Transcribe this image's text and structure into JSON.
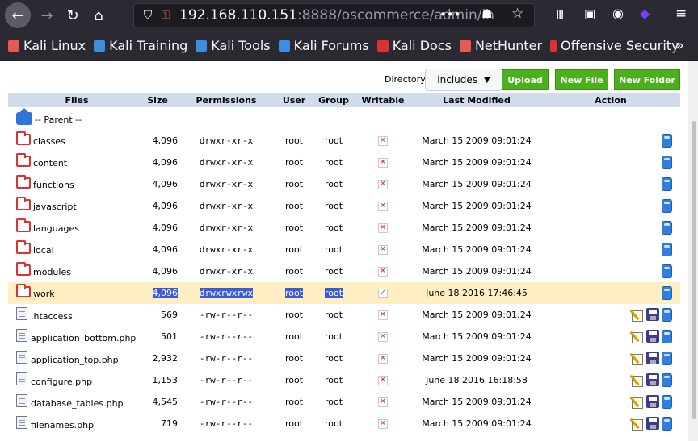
{
  "browser": {
    "url_host": "192.168.110.151",
    "url_path": ":8888/oscommerce/admin/in",
    "bookmarks": [
      {
        "label": "Kali Linux",
        "color": "#e85a4f"
      },
      {
        "label": "Kali Training",
        "color": "#3b8fe0"
      },
      {
        "label": "Kali Tools",
        "color": "#3b8fe0"
      },
      {
        "label": "Kali Forums",
        "color": "#3b8fe0"
      },
      {
        "label": "Kali Docs",
        "color": "#e03030"
      },
      {
        "label": "NetHunter",
        "color": "#e85a4f"
      },
      {
        "label": "Offensive Security",
        "color": "#e03030"
      }
    ],
    "overflow": "»"
  },
  "toolbar": {
    "directory_label": "Directory:",
    "directory_value": "includes",
    "upload_label": "Upload",
    "newfile_label": "New File",
    "newfolder_label": "New Folder"
  },
  "table": {
    "headers": {
      "files": "Files",
      "size": "Size",
      "permissions": "Permissions",
      "user": "User",
      "group": "Group",
      "writable": "Writable",
      "modified": "Last Modified",
      "action": "Action"
    },
    "parent_label": "-- Parent --",
    "rows": [
      {
        "name": "classes",
        "type": "folder",
        "size": "4,096",
        "perm": "drwxr-xr-x",
        "user": "root",
        "group": "root",
        "writable": false,
        "modified": "March 15 2009 09:01:24"
      },
      {
        "name": "content",
        "type": "folder",
        "size": "4,096",
        "perm": "drwxr-xr-x",
        "user": "root",
        "group": "root",
        "writable": false,
        "modified": "March 15 2009 09:01:24"
      },
      {
        "name": "functions",
        "type": "folder",
        "size": "4,096",
        "perm": "drwxr-xr-x",
        "user": "root",
        "group": "root",
        "writable": false,
        "modified": "March 15 2009 09:01:24"
      },
      {
        "name": "javascript",
        "type": "folder",
        "size": "4,096",
        "perm": "drwxr-xr-x",
        "user": "root",
        "group": "root",
        "writable": false,
        "modified": "March 15 2009 09:01:24"
      },
      {
        "name": "languages",
        "type": "folder",
        "size": "4,096",
        "perm": "drwxr-xr-x",
        "user": "root",
        "group": "root",
        "writable": false,
        "modified": "March 15 2009 09:01:24"
      },
      {
        "name": "local",
        "type": "folder",
        "size": "4,096",
        "perm": "drwxr-xr-x",
        "user": "root",
        "group": "root",
        "writable": false,
        "modified": "March 15 2009 09:01:24"
      },
      {
        "name": "modules",
        "type": "folder",
        "size": "4,096",
        "perm": "drwxr-xr-x",
        "user": "root",
        "group": "root",
        "writable": false,
        "modified": "March 15 2009 09:01:24"
      },
      {
        "name": "work",
        "type": "folder",
        "size": "4,096",
        "perm": "drwxrwxrwx",
        "user": "root",
        "group": "root",
        "writable": true,
        "modified": "June 18 2016 17:46:45",
        "selected": true
      },
      {
        "name": ".htaccess",
        "type": "file",
        "size": "569",
        "perm": "-rw-r--r--",
        "user": "root",
        "group": "root",
        "writable": false,
        "modified": "March 15 2009 09:01:24"
      },
      {
        "name": "application_bottom.php",
        "type": "file",
        "size": "501",
        "perm": "-rw-r--r--",
        "user": "root",
        "group": "root",
        "writable": false,
        "modified": "March 15 2009 09:01:24"
      },
      {
        "name": "application_top.php",
        "type": "file",
        "size": "2,932",
        "perm": "-rw-r--r--",
        "user": "root",
        "group": "root",
        "writable": false,
        "modified": "March 15 2009 09:01:24"
      },
      {
        "name": "configure.php",
        "type": "file",
        "size": "1,153",
        "perm": "-rw-r--r--",
        "user": "root",
        "group": "root",
        "writable": false,
        "modified": "June 18 2016 16:18:58"
      },
      {
        "name": "database_tables.php",
        "type": "file",
        "size": "4,545",
        "perm": "-rw-r--r--",
        "user": "root",
        "group": "root",
        "writable": false,
        "modified": "March 15 2009 09:01:24"
      },
      {
        "name": "filenames.php",
        "type": "file",
        "size": "719",
        "perm": "-rw-r--r--",
        "user": "root",
        "group": "root",
        "writable": false,
        "modified": "March 15 2009 09:01:24"
      }
    ]
  }
}
